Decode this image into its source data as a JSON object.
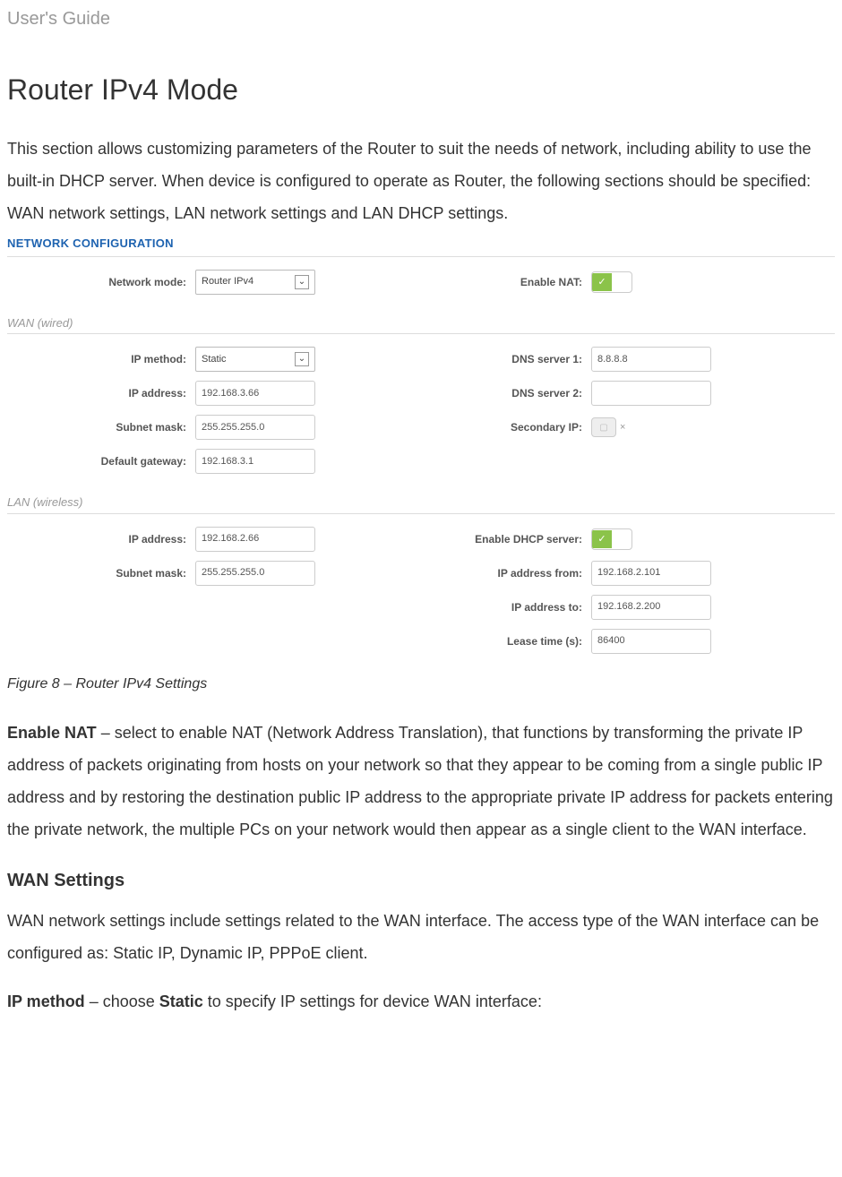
{
  "header": "User's Guide",
  "section_title": "Router IPv4 Mode",
  "intro_para": "This section allows customizing parameters of the Router to suit the needs of network, including ability to use the built-in DHCP server. When device is configured to operate as Router, the following sections should be specified: WAN network settings, LAN network settings and LAN DHCP settings.",
  "figure_title": "NETWORK CONFIGURATION",
  "fields": {
    "network_mode_label": "Network mode:",
    "network_mode_value": "Router IPv4",
    "enable_nat_label": "Enable NAT:",
    "wan_group": "WAN (wired)",
    "ip_method_label": "IP method:",
    "ip_method_value": "Static",
    "ip_address_label": "IP address:",
    "ip_address_value": "192.168.3.66",
    "subnet_mask_label": "Subnet mask:",
    "subnet_mask_value": "255.255.255.0",
    "default_gateway_label": "Default gateway:",
    "default_gateway_value": "192.168.3.1",
    "dns1_label": "DNS server 1:",
    "dns1_value": "8.8.8.8",
    "dns2_label": "DNS server 2:",
    "dns2_value": "",
    "secondary_ip_label": "Secondary IP:",
    "lan_group": "LAN (wireless)",
    "lan_ip_address_label": "IP address:",
    "lan_ip_address_value": "192.168.2.66",
    "lan_subnet_mask_label": "Subnet mask:",
    "lan_subnet_mask_value": "255.255.255.0",
    "enable_dhcp_label": "Enable DHCP server:",
    "ip_from_label": "IP address from:",
    "ip_from_value": "192.168.2.101",
    "ip_to_label": "IP address to:",
    "ip_to_value": "192.168.2.200",
    "lease_label": "Lease time (s):",
    "lease_value": "86400"
  },
  "caption": "Figure 8 – Router IPv4 Settings",
  "nat_para_b": "Enable NAT",
  "nat_para": " – select to enable NAT (Network Address Translation), that functions by transforming the private IP address of packets originating from hosts on your network so that they appear to be coming from a single public IP address and by restoring the destination public IP address to the appropriate private IP address for packets entering the private network, the multiple PCs on your network would then appear as a single client to the WAN interface.",
  "wan_sub": "WAN Settings",
  "wan_para": "WAN network settings include settings related to the WAN interface. The access type of the WAN interface can be configured as: Static IP, Dynamic IP, PPPoE client.",
  "ipmethod_b": "IP method",
  "ipmethod_mid": " – choose ",
  "ipmethod_b2": "Static",
  "ipmethod_tail": " to specify IP settings for device WAN interface:",
  "check_glyph": "✓",
  "x_glyph": "×"
}
